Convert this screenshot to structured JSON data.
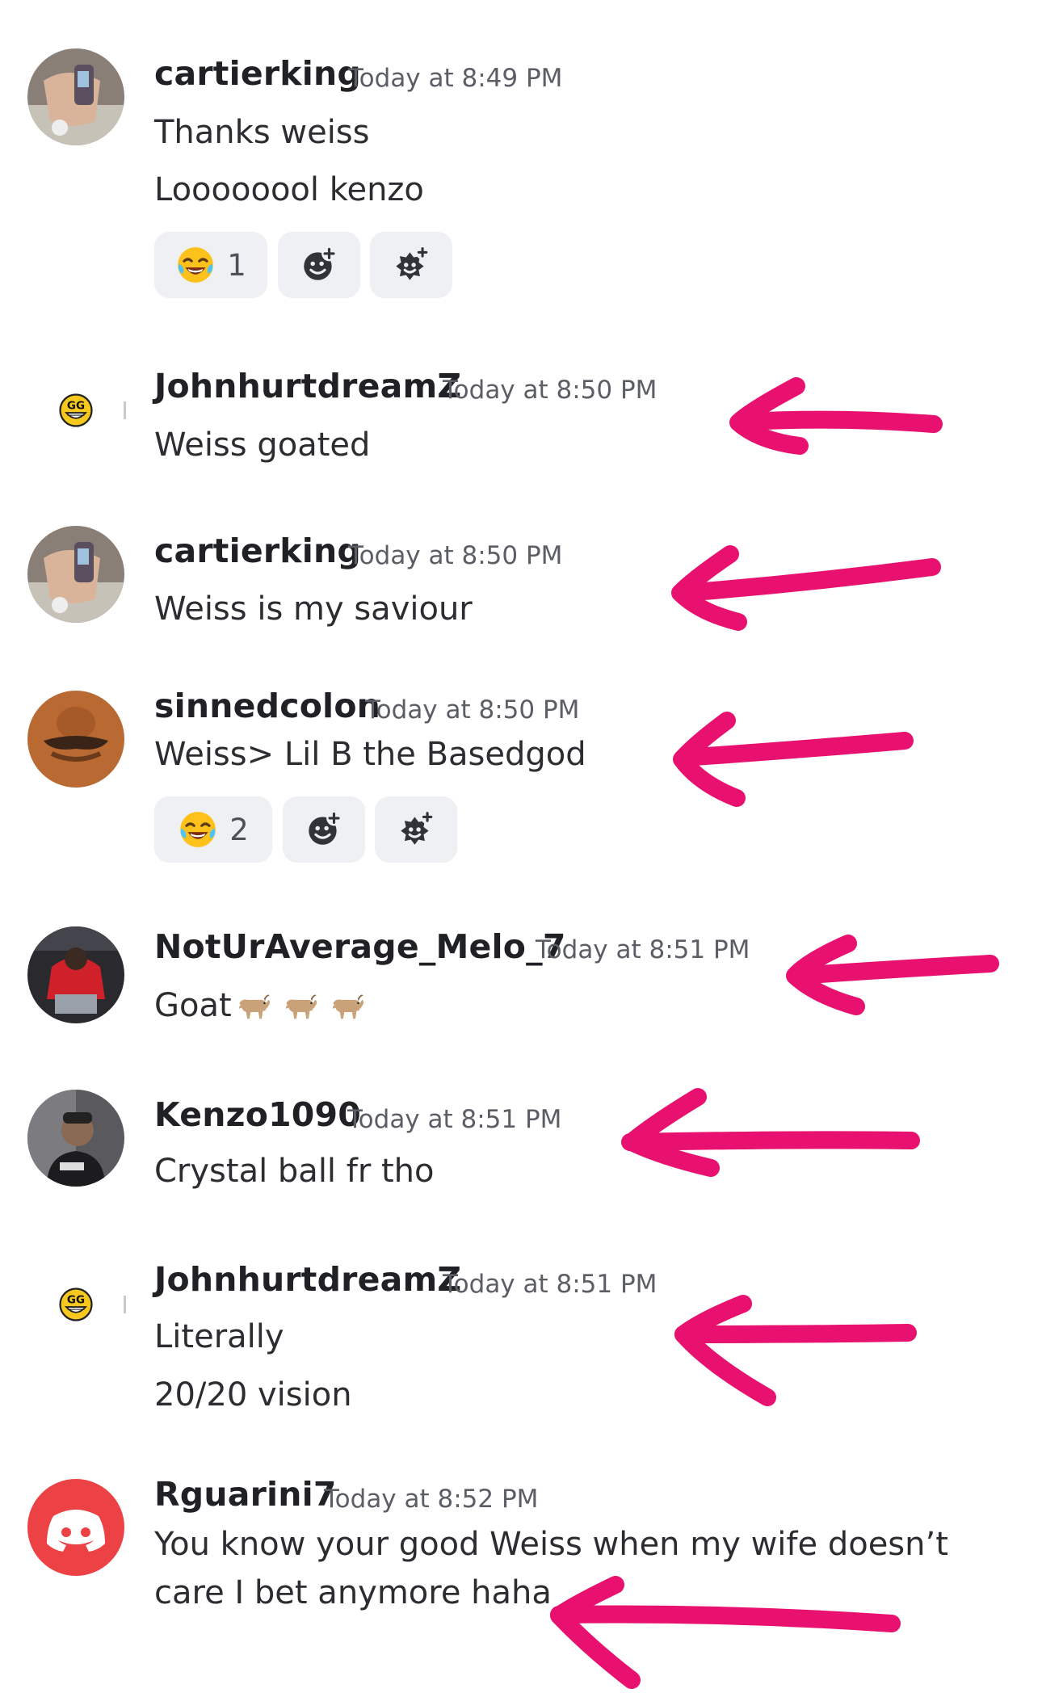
{
  "messages": [
    {
      "username": "cartierking",
      "timestamp": "Today at 8:49 PM",
      "lines": [
        "Thanks weiss",
        "Loooooool kenzo"
      ],
      "reactions": {
        "emoji": "joy",
        "count": "1"
      }
    },
    {
      "username": "JohnhurtdreamZ",
      "timestamp": "Today at 8:50 PM",
      "lines": [
        "Weiss goated"
      ]
    },
    {
      "username": "cartierking",
      "timestamp": "Today at 8:50 PM",
      "lines": [
        "Weiss is my saviour"
      ]
    },
    {
      "username": "sinnedcolon",
      "timestamp": "Today at 8:50 PM",
      "lines": [
        "Weiss> Lil B the Basedgod"
      ],
      "reactions": {
        "emoji": "joy",
        "count": "2"
      }
    },
    {
      "username": "NotUrAverage_Melo_7",
      "timestamp": "Today at 8:51 PM",
      "lines": [
        "Goat"
      ],
      "goat_emojis": 3
    },
    {
      "username": "Kenzo1090",
      "timestamp": "Today at 8:51 PM",
      "lines": [
        "Crystal ball fr tho"
      ]
    },
    {
      "username": "JohnhurtdreamZ",
      "timestamp": "Today at 8:51 PM",
      "lines": [
        "Literally",
        "20/20 vision"
      ]
    },
    {
      "username": "Rguarini7",
      "timestamp": "Today at 8:52 PM",
      "lines": [
        "You know your good Weiss when my wife doesn’t care I bet anymore haha"
      ]
    }
  ],
  "icons": {
    "reaction_emoji": "joy-emoji",
    "add_reaction": "add-reaction-icon",
    "add_super_reaction": "add-super-reaction-icon",
    "goat": "goat-emoji",
    "discord_default_avatar": "discord-logo-icon"
  },
  "colors": {
    "annotation_arrow": "#e8116f",
    "discord_red": "#ed4245",
    "reaction_bg": "#eef0f3"
  }
}
